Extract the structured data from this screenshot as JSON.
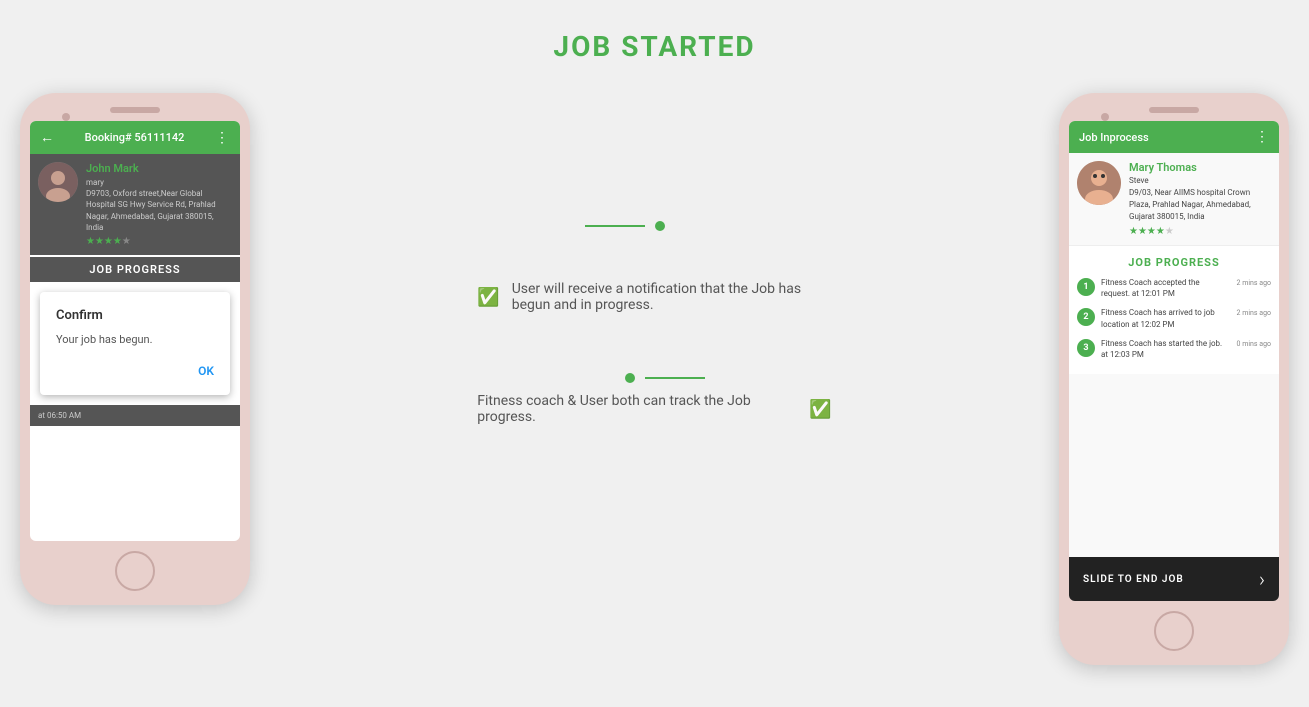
{
  "page": {
    "title": "JOB STARTED",
    "title_color": "#4caf50"
  },
  "left_phone": {
    "header": {
      "back": "←",
      "booking": "Booking# 56111142",
      "menu": "⋮"
    },
    "profile": {
      "name": "John Mark",
      "sub_name": "mary",
      "address": "D9703, Oxford street,Near Global Hospital SG Hwy Service Rd, Prahlad Nagar, Ahmedabad, Gujarat 380015, India",
      "stars": "★★★★",
      "star_empty": "★"
    },
    "job_progress_label": "JOB PROGRESS",
    "confirm_dialog": {
      "title": "Confirm",
      "message": "Your job has begun.",
      "ok_label": "OK"
    },
    "bottom_time": "at 06:50 AM"
  },
  "right_phone": {
    "header": {
      "title": "Job Inprocess",
      "menu": "⋮"
    },
    "profile": {
      "name": "Mary Thomas",
      "role": "Steve",
      "address": "D9/03, Near AIIMS hospital Crown Plaza, Prahlad Nagar, Ahmedabad, Gujarat 380015, India",
      "stars": "★★★★",
      "star_empty": "★"
    },
    "job_progress": {
      "title": "JOB PROGRESS",
      "items": [
        {
          "number": "1",
          "text": "Fitness Coach accepted the request. at 12:01 PM",
          "time": "2 mins ago"
        },
        {
          "number": "2",
          "text": "Fitness Coach has arrived to job location at 12:02 PM",
          "time": "2 mins ago"
        },
        {
          "number": "3",
          "text": "Fitness Coach has started the job. at 12:03 PM",
          "time": "0 mins ago"
        }
      ]
    },
    "slide_button": {
      "label": "SLIDE TO END JOB",
      "arrow": "›"
    }
  },
  "middle": {
    "notification_text": "User will receive a notification that the Job has begun and in progress.",
    "tracking_text": "Fitness coach & User both can track the Job progress."
  }
}
